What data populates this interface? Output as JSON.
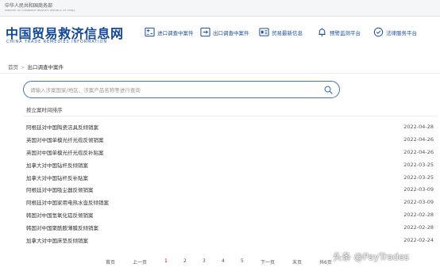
{
  "top": {
    "ministry": "中华人民共和国商务部",
    "ministry_en": "MINISTRY OF COMMERCE PEOPLE'S REPUBLIC OF CHINA"
  },
  "logo": {
    "cn": "中国贸易救济信息网",
    "en": "CHINA TRADE REMEDIES INFORMATION"
  },
  "nav": [
    {
      "label": "进口调查中案件",
      "icon": "import-case-icon"
    },
    {
      "label": "出口调查中案件",
      "icon": "export-case-icon"
    },
    {
      "label": "贸易最新信息",
      "icon": "news-icon"
    },
    {
      "label": "预警监测平台",
      "icon": "bell-icon"
    },
    {
      "label": "法律服务平台",
      "icon": "legal-icon"
    }
  ],
  "breadcrumb": {
    "home": "首页",
    "sep": ">",
    "current": "出口调查中案件"
  },
  "search": {
    "placeholder": "请输入涉案国家/地区、涉案产品名称等进行查询"
  },
  "sort_label": "按立案时间排序",
  "cases": [
    {
      "title": "阿根廷对中国陶瓷洁具反倾销案",
      "date": "2022-04-28"
    },
    {
      "title": "英国对中国单模光纤光缆反倾销案",
      "date": "2022-04-26"
    },
    {
      "title": "英国对中国单模光纤光缆反补贴案",
      "date": "2022-04-26"
    },
    {
      "title": "加拿大对中国钻杆反倾销案",
      "date": "2022-03-25"
    },
    {
      "title": "加拿大对中国钻杆反补贴案",
      "date": "2022-03-25"
    },
    {
      "title": "阿根廷对中国吸尘器反倾销案",
      "date": "2022-03-09"
    },
    {
      "title": "阿根廷对中国家用电热水壶反倾销案",
      "date": "2022-03-09"
    },
    {
      "title": "韩国对中国氢氧化铝反倾销案",
      "date": "2022-02-28"
    },
    {
      "title": "韩国对中国聚酰胺薄膜反倾销案",
      "date": "2022-02-28"
    },
    {
      "title": "加拿大对中国床垫反倾销案",
      "date": "2022-02-24"
    }
  ],
  "pager": {
    "first": "首页",
    "prev": "上一页",
    "pages": [
      "1",
      "2",
      "3",
      "4",
      "5"
    ],
    "current": "1",
    "next": "下一页",
    "last": "末页",
    "total": "共6页"
  },
  "watermark": "头条 @PayTrades",
  "colors": {
    "brand": "#12479a",
    "accent": "#3a73c9",
    "active_page": "#d0021b"
  }
}
